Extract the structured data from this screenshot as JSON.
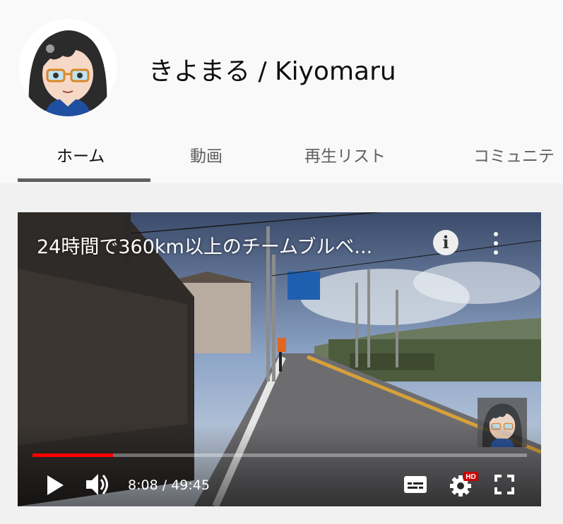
{
  "channel": {
    "name": "きよまる / Kiyomaru"
  },
  "tabs": [
    {
      "label": "ホーム",
      "active": true
    },
    {
      "label": "動画",
      "active": false
    },
    {
      "label": "再生リスト",
      "active": false
    },
    {
      "label": "コミュニテ",
      "active": false
    }
  ],
  "player": {
    "title": "24時間で360km以上のチームブルベ...",
    "current_time": "8:08",
    "duration": "49:45",
    "time_display": "8:08 / 49:45",
    "progress_fraction": 0.163,
    "hd_badge": "HD",
    "icons": [
      "info-icon",
      "more-vert-icon",
      "play-icon",
      "volume-icon",
      "subtitles-icon",
      "settings-icon",
      "fullscreen-icon"
    ]
  },
  "colors": {
    "progress": "#ff0000",
    "hd_badge": "#cc0000",
    "header_bg": "#f9f9f9",
    "page_bg": "#f1f1f1"
  }
}
